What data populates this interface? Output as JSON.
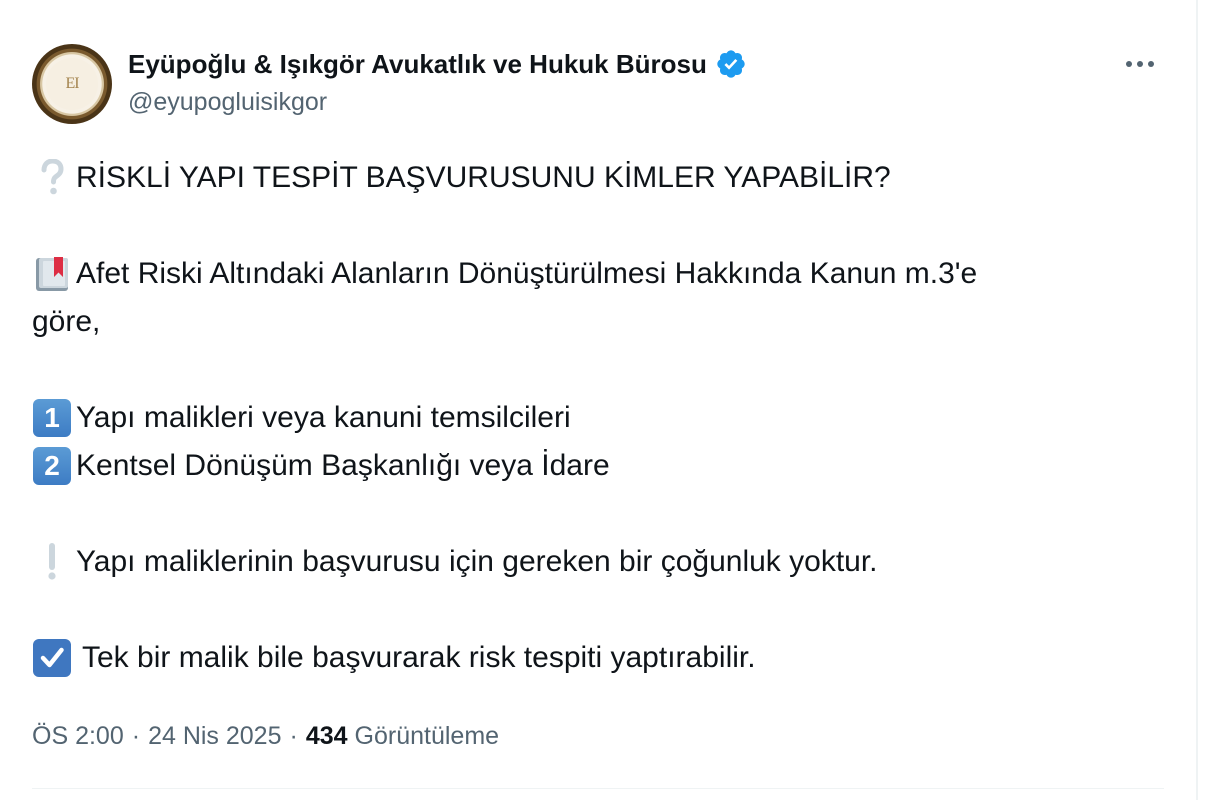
{
  "author": {
    "display_name": "Eyüpoğlu & Işıkgör Avukatlık ve Hukuk Bürosu",
    "handle": "@eyupogluisikgor",
    "avatar_monogram": "EI",
    "verified": true,
    "verified_color": "#1d9bf0"
  },
  "tweet": {
    "line1_icon": "question-mark-icon",
    "line1": "RİSKLİ YAPI TESPİT BAŞVURUSUNU KİMLER YAPABİLİR?",
    "line2_icon": "bookmark-book-icon",
    "line2a": "Afet Riski Altındaki Alanların Dönüştürülmesi Hakkında Kanun m.3'e",
    "line2b": "göre,",
    "item1_icon_label": "1",
    "item1": "Yapı malikleri veya kanuni temsilcileri",
    "item2_icon_label": "2",
    "item2": "Kentsel Dönüşüm Başkanlığı veya İdare",
    "line3_icon": "exclamation-icon",
    "line3": "Yapı maliklerinin başvurusu için gereken bir çoğunluk yoktur.",
    "line4_icon": "checkbox-icon",
    "line4": "Tek bir malik bile başvurarak risk tespiti yaptırabilir."
  },
  "meta": {
    "time": "ÖS 2:00",
    "separator": "·",
    "date": "24 Nis 2025",
    "views_count": "434",
    "views_label": "Görüntüleme"
  },
  "colors": {
    "text_primary": "#0f1419",
    "text_secondary": "#536471",
    "accent": "#1d9bf0",
    "divider": "#eff3f4"
  }
}
